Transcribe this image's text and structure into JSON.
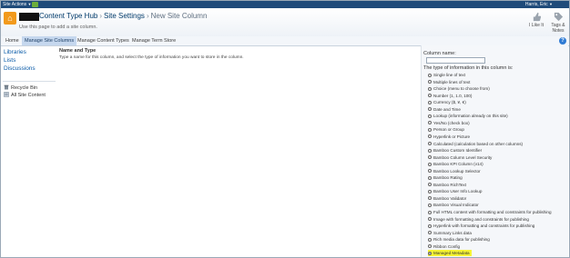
{
  "topbar": {
    "site_actions": "Site Actions",
    "user_name": "Harris, Eric"
  },
  "header": {
    "breadcrumb": [
      "Content Type Hub",
      "Site Settings",
      "New Site Column"
    ],
    "separator": "›",
    "subtitle": "Use this page to add a site column.",
    "like_label": "I Like It",
    "tags_label": "Tags & Notes"
  },
  "nav": {
    "tabs": [
      "Home",
      "Manage Site Columns",
      "Manage Content Types",
      "Manage Term Store"
    ],
    "active_tab": 1
  },
  "leftnav": {
    "links": [
      "Libraries",
      "Lists",
      "Discussions"
    ],
    "utilities": [
      "Recycle Bin",
      "All Site Content"
    ]
  },
  "main": {
    "section_title": "Name and Type",
    "section_desc": "Type a name for this column, and select the type of information you want to store in the column.",
    "column_name_label": "Column name:",
    "column_name_value": "",
    "type_label": "The type of information in this column is:",
    "options": [
      "Single line of text",
      "Multiple lines of text",
      "Choice (menu to choose from)",
      "Number (1, 1.0, 100)",
      "Currency ($, ¥, €)",
      "Date and Time",
      "Lookup (information already on this site)",
      "Yes/No (check box)",
      "Person or Group",
      "Hyperlink or Picture",
      "Calculated (calculation based on other columns)",
      "Bamboo Custom Identifier",
      "Bamboo Column Level Security",
      "Bamboo KPI Column (v14)",
      "Bamboo Lookup Selector",
      "Bamboo Rating",
      "Bamboo RichText",
      "Bamboo User Info Lookup",
      "Bamboo Validator",
      "Bamboo Visual Indicator",
      "Full HTML content with formatting and constraints for publishing",
      "Image with formatting and constraints for publishing",
      "Hyperlink with formatting and constraints for publishing",
      "Summary Links data",
      "Rich media data for publishing",
      "Ribbon Config",
      "Managed Metadata"
    ],
    "selected_index": 26,
    "highlight_color": "#f6f433"
  }
}
